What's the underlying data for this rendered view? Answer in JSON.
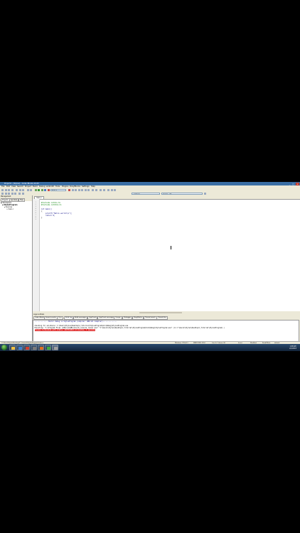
{
  "window": {
    "title": "Project1 - [Stylus] - Code::Blocks 10.05",
    "controls": [
      "_",
      "□",
      "×"
    ]
  },
  "menu": [
    "File",
    "Edit",
    "View",
    "Search",
    "Project",
    "Build",
    "Debug",
    "wxSmith",
    "Tools",
    "Plugins",
    "DoxyBlocks",
    "Settings",
    "Help"
  ],
  "toolbar": {
    "target_value": "Debug",
    "scope_value": "<global>",
    "symbol_value": "main() : int"
  },
  "left_pane": {
    "header": "Management",
    "tabs": [
      "Projects",
      "Symbols",
      "Files"
    ],
    "tree": [
      "Workspace",
      "StylusProgram",
      "Sources",
      "main.c"
    ]
  },
  "editor": {
    "tab": "main.c",
    "lines": [
      "1",
      "2",
      "3",
      "4",
      "5",
      "6",
      "7",
      "8",
      "9"
    ],
    "code": [
      "#include <stdio.h>",
      "#include <stdlib.h>",
      "",
      "int main()",
      "{",
      "    printf(\"Hello world!\\n\");",
      "    return 0;",
      "}",
      ""
    ]
  },
  "log": {
    "header": "Logs & others",
    "tabs": [
      "Code::Blocks",
      "Search results",
      "Cccc",
      "Build log",
      "Build messages",
      "CppCheck",
      "CppCheck messages",
      "Cscope",
      "Debugger",
      "DoxyBlocks",
      "Thread search",
      "Closed files"
    ],
    "active_tab_index": 3,
    "lines": [
      "-------------- Build: Debug in StylusProgram (compiler: GNU GCC Compiler)---------------",
      "",
      "Checking for existence: C:\\Users\\Stylus\\Desktop\\C_Tutorial\\StylusProgram\\bin\\Debug\\StylusProgram.exe",
      "Executing: \"C:\\Program Files (x86)\\CodeBlocks/cb_console_runner.exe\" \"C:\\Users\\Stylus\\Desktop\\C_Tutorial\\StylusProgram\\bin\\Debug\\StylusProgram.exe\"  (in C:\\Users\\Stylus\\Desktop\\C_Tutorial\\StylusProgram\\.)",
      "Process terminated with status -1073741510 (0 minutes, 3 seconds)"
    ]
  },
  "status": {
    "path": "C:\\Users\\Stylus\\Desktop\\C_Tutorial\\StylusProgram\\main.c",
    "encoding": "Windows (CR+LF)",
    "charset": "WINDOWS-1252",
    "position": "Line 6, Column 30",
    "mode": "Insert",
    "modified": "Modified",
    "rw": "Read/Write",
    "profile": "default"
  },
  "taskbar": {
    "time": "1:08 AM",
    "date": "2/1/2013",
    "app_colors": [
      "#f0c040",
      "#3c7fd0",
      "#d04030",
      "#7a7a7a",
      "#e07020",
      "#3fae3f",
      "#a0a0a0"
    ]
  }
}
